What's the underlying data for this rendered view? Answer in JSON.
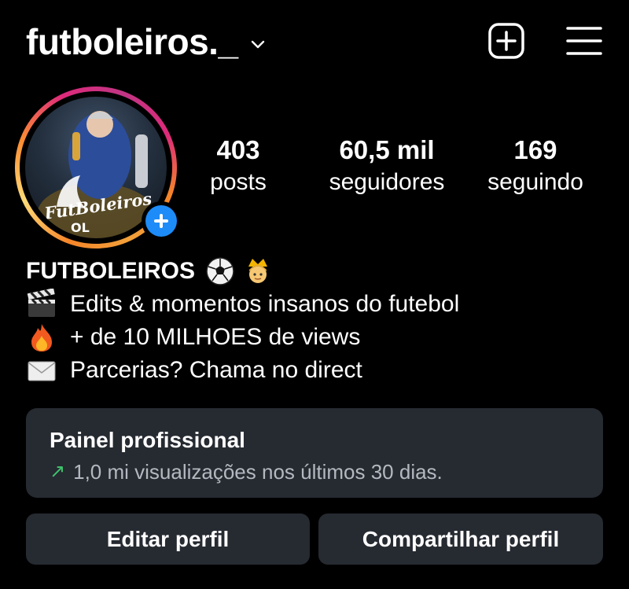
{
  "header": {
    "username": "futboleiros._",
    "dropdown_icon": "chevron-down-icon",
    "new_post_icon": "plus-square-icon",
    "menu_icon": "hamburger-menu-icon"
  },
  "avatar": {
    "photo_text": "FutBoleiros",
    "photo_subtext": "OL",
    "add_story_icon": "plus-circle-icon"
  },
  "stats": {
    "posts": {
      "value": "403",
      "label": "posts"
    },
    "followers": {
      "value": "60,5 mil",
      "label": "seguidores"
    },
    "following": {
      "value": "169",
      "label": "seguindo"
    }
  },
  "bio": {
    "name": "FUTBOLEIROS",
    "name_emojis": [
      "soccer-ball-icon",
      "crown-person-icon"
    ],
    "lines": [
      {
        "icon": "clapperboard-icon",
        "text": "Edits & momentos insanos do futebol"
      },
      {
        "icon": "fire-icon",
        "text": "+ de 10 MILHOES de views"
      },
      {
        "icon": "envelope-icon",
        "text": "Parcerias? Chama no direct"
      }
    ]
  },
  "professional_panel": {
    "title": "Painel profissional",
    "subtitle": "1,0 mi visualizações nos últimos 30 dias.",
    "trend_icon": "arrow-up-right-icon"
  },
  "buttons": {
    "edit_profile": "Editar perfil",
    "share_profile": "Compartilhar perfil"
  },
  "colors": {
    "background": "#000000",
    "panel": "#262a31",
    "accent_blue": "#1d8cf8",
    "trend_green": "#3ec46d"
  }
}
